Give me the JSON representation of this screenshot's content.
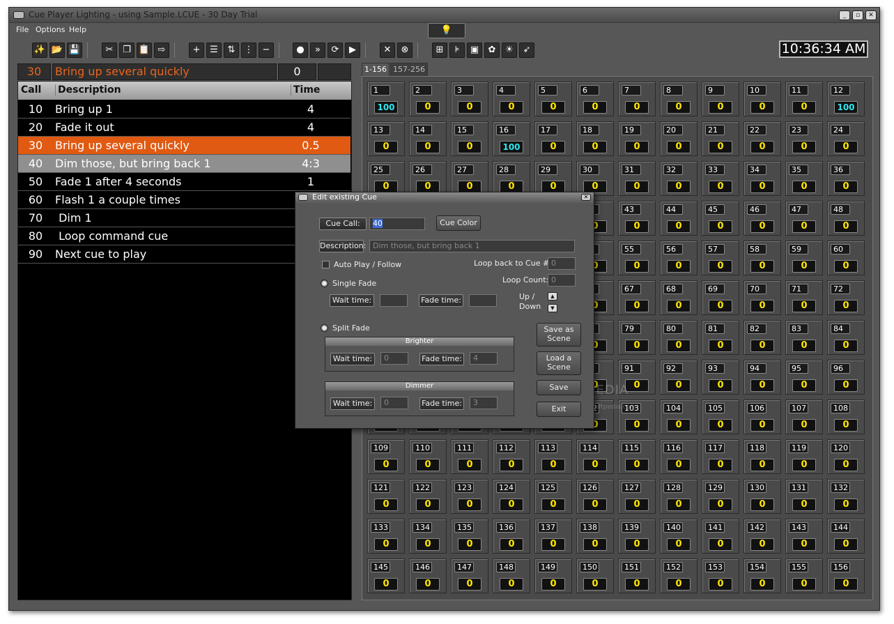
{
  "window": {
    "title": "Cue Player Lighting - using Sample.LCUE - 30 Day Trial"
  },
  "menu": [
    "File",
    "Options",
    "Help"
  ],
  "toolbar": {
    "groups": [
      [
        {
          "name": "new-wand-icon",
          "glyph": "✨"
        },
        {
          "name": "open-folder-icon",
          "glyph": "📂"
        },
        {
          "name": "save-disk-icon",
          "glyph": "💾"
        }
      ],
      [
        {
          "name": "cut-icon",
          "glyph": "✂"
        },
        {
          "name": "copy-icon",
          "glyph": "❐"
        },
        {
          "name": "paste-icon",
          "glyph": "📋"
        },
        {
          "name": "export-icon",
          "glyph": "⇨"
        }
      ],
      [
        {
          "name": "add-cue-icon",
          "glyph": "+"
        },
        {
          "name": "insert-cue-icon",
          "glyph": "☰"
        },
        {
          "name": "move-cue-icon",
          "glyph": "⇅"
        },
        {
          "name": "split-cue-icon",
          "glyph": "⋮"
        },
        {
          "name": "remove-cue-icon",
          "glyph": "−"
        }
      ],
      [
        {
          "name": "record-icon",
          "glyph": "●"
        },
        {
          "name": "fast-forward-icon",
          "glyph": "»"
        },
        {
          "name": "refresh-icon",
          "glyph": "⟳"
        },
        {
          "name": "play-icon",
          "glyph": "▶"
        }
      ],
      [
        {
          "name": "stop-x-icon",
          "glyph": "✕"
        },
        {
          "name": "cancel-icon",
          "glyph": "⊗"
        }
      ],
      [
        {
          "name": "tree-icon",
          "glyph": "⊞"
        },
        {
          "name": "fader-icon",
          "glyph": "⊧"
        },
        {
          "name": "monitor-icon",
          "glyph": "▣"
        },
        {
          "name": "palette-icon",
          "glyph": "✿"
        },
        {
          "name": "stage-lamp-icon",
          "glyph": "☀"
        },
        {
          "name": "pointer-icon",
          "glyph": "➶"
        }
      ]
    ]
  },
  "clock": "10:36:34 AM",
  "bulb_glyph": "💡",
  "current_cue": {
    "number": "30",
    "description": "Bring up several quickly",
    "count": "0"
  },
  "cue_list": {
    "headers": {
      "call": "Call",
      "description": "Description",
      "time": "Time"
    },
    "rows": [
      {
        "call": "10",
        "description": "Bring up 1",
        "time": "4",
        "state": "normal"
      },
      {
        "call": "20",
        "description": "Fade it out",
        "time": "4",
        "state": "normal"
      },
      {
        "call": "30",
        "description": "Bring up several quickly",
        "time": "0.5",
        "state": "active"
      },
      {
        "call": "40",
        "description": "Dim those, but bring back 1",
        "time": "4:3",
        "state": "selected"
      },
      {
        "call": "50",
        "description": "Fade 1 after 4 seconds",
        "time": "1",
        "state": "normal"
      },
      {
        "call": "60",
        "description": "Flash 1 a couple times",
        "time": "",
        "state": "normal"
      },
      {
        "call": "70",
        "description": " Dim 1",
        "time": "",
        "state": "normal"
      },
      {
        "call": "80",
        "description": " Loop command cue",
        "time": "",
        "state": "normal"
      },
      {
        "call": "90",
        "description": "Next cue to play",
        "time": "",
        "state": "normal"
      }
    ]
  },
  "tabs": [
    {
      "label": "1-156",
      "active": true
    },
    {
      "label": "157-256",
      "active": false
    }
  ],
  "channels": {
    "first": 1,
    "last": 156,
    "per_row": 12,
    "default_level": "0",
    "highlighted": {
      "1": "100",
      "12": "100",
      "16": "100"
    }
  },
  "dialog": {
    "title": "Edit existing Cue",
    "cue_call_label": "Cue Call:",
    "cue_call_value": "40",
    "cue_color_label": "Cue Color",
    "description_label": "Description:",
    "description_value": "Dim those, but bring back 1",
    "auto_play_label": "Auto Play / Follow",
    "loop_back_label": "Loop back to Cue #:",
    "loop_back_value": "0",
    "loop_count_label": "Loop Count:",
    "loop_count_value": "0",
    "single_fade_label": "Single Fade",
    "wait_time_label": "Wait time:",
    "fade_time_label": "Fade time:",
    "up_down_label": "Up /\nDown",
    "up_label": "Up /",
    "down_label": "Down",
    "split_fade_label": "Split Fade",
    "brighter_label": "Brighter",
    "brighter_wait": "0",
    "brighter_fade": "4",
    "dimmer_label": "Dimmer",
    "dimmer_wait": "0",
    "dimmer_fade": "3",
    "save_as_scene_1": "Save as",
    "save_as_scene_2": "Scene",
    "load_scene_1": "Load a",
    "load_scene_2": "Scene",
    "save_label": "Save",
    "exit_label": "Exit"
  },
  "watermark": {
    "brand": "SOFTPEDIA",
    "url": "www.softpedia.com"
  },
  "colors": {
    "active_row": "#e05a12",
    "selected_row": "#8f8f8f",
    "level_text": "#ffe600",
    "level_full": "#2ee6ee"
  }
}
